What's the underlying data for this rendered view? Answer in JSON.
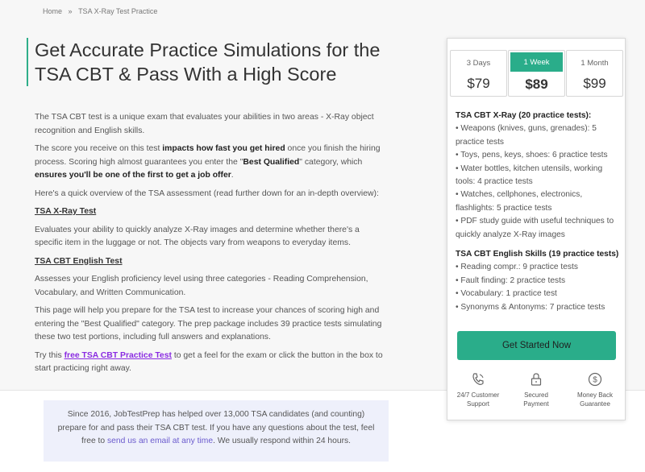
{
  "breadcrumb": {
    "home": "Home",
    "separator": "»",
    "current": "TSA X-Ray Test Practice"
  },
  "title": "Get Accurate Practice Simulations for the TSA CBT & Pass With a High Score",
  "content": {
    "p1": "The TSA CBT test is a unique exam that evaluates your abilities in two areas - X-Ray object recognition and English skills.",
    "p2a": "The score you receive on this test ",
    "p2b": "impacts how fast you get hired",
    "p2c": " once you finish the hiring process. Scoring high almost guarantees you enter the \"",
    "p2d": "Best Qualified",
    "p2e": "\" category, which ",
    "p2f": "ensures you'll be one of the first to get a job offer",
    "p2g": ".",
    "p3": "Here's a quick overview of the TSA assessment (read further down for an in-depth overview):",
    "xray_heading": "TSA X-Ray Test",
    "p4": "Evaluates your ability to quickly analyze X-Ray images and determine whether there's a specific item in the luggage or not. The objects vary from weapons to everyday items.",
    "english_heading": "TSA CBT English Test",
    "p5": "Assesses your English proficiency level using three categories - Reading Comprehension, Vocabulary, and Written Communication.",
    "p6": "This page will help you prepare for the TSA test to increase your chances of scoring high and entering the \"Best Qualified\" category. The prep package includes 39 practice tests simulating these two test portions, including full answers and explanations.",
    "p7a": "Try this ",
    "p7link": "free TSA CBT Practice Test",
    "p7b": " to get a feel for the exam or click the button in the box to start practicing right away."
  },
  "info_box": {
    "text_a": "Since 2016, JobTestPrep has helped over 13,000 TSA candidates (and counting) prepare for and pass their TSA CBT test. If you have any questions about the test, feel free to ",
    "link": "send us an email at any time",
    "text_b": ". We usually respond within 24 hours."
  },
  "card": {
    "plans": [
      {
        "duration": "3 Days",
        "price": "$79",
        "selected": false
      },
      {
        "duration": "1 Week",
        "price": "$89",
        "selected": true
      },
      {
        "duration": "1 Month",
        "price": "$99",
        "selected": false
      }
    ],
    "xray_head": "TSA CBT X-Ray (20 practice tests):",
    "xray_items": [
      "• Weapons (knives, guns, grenades): 5 practice tests",
      "• Toys, pens, keys, shoes: 6 practice tests",
      "• Water bottles, kitchen utensils, working tools: 4 practice tests",
      "• Watches, cellphones, electronics, flashlights: 5 practice tests",
      "• PDF study guide with useful techniques to quickly analyze X-Ray images"
    ],
    "english_head": "TSA CBT English Skills (19 practice tests)",
    "english_items": [
      "• Reading compr.: 9 practice tests",
      "• Fault finding: 2 practice tests",
      "• Vocabulary: 1 practice test",
      "• Synonyms & Antonyms: 7 practice tests"
    ],
    "cta": "Get Started Now",
    "guarantees": [
      {
        "icon": "phone-icon",
        "line1": "24/7 Customer",
        "line2": "Support"
      },
      {
        "icon": "lock-icon",
        "line1": "Secured",
        "line2": "Payment"
      },
      {
        "icon": "dollar-icon",
        "line1": "Money Back",
        "line2": "Guarantee"
      }
    ]
  },
  "colors": {
    "accent": "#2aad8a",
    "link": "#8a2be2",
    "info_bg": "#eef0fb"
  }
}
